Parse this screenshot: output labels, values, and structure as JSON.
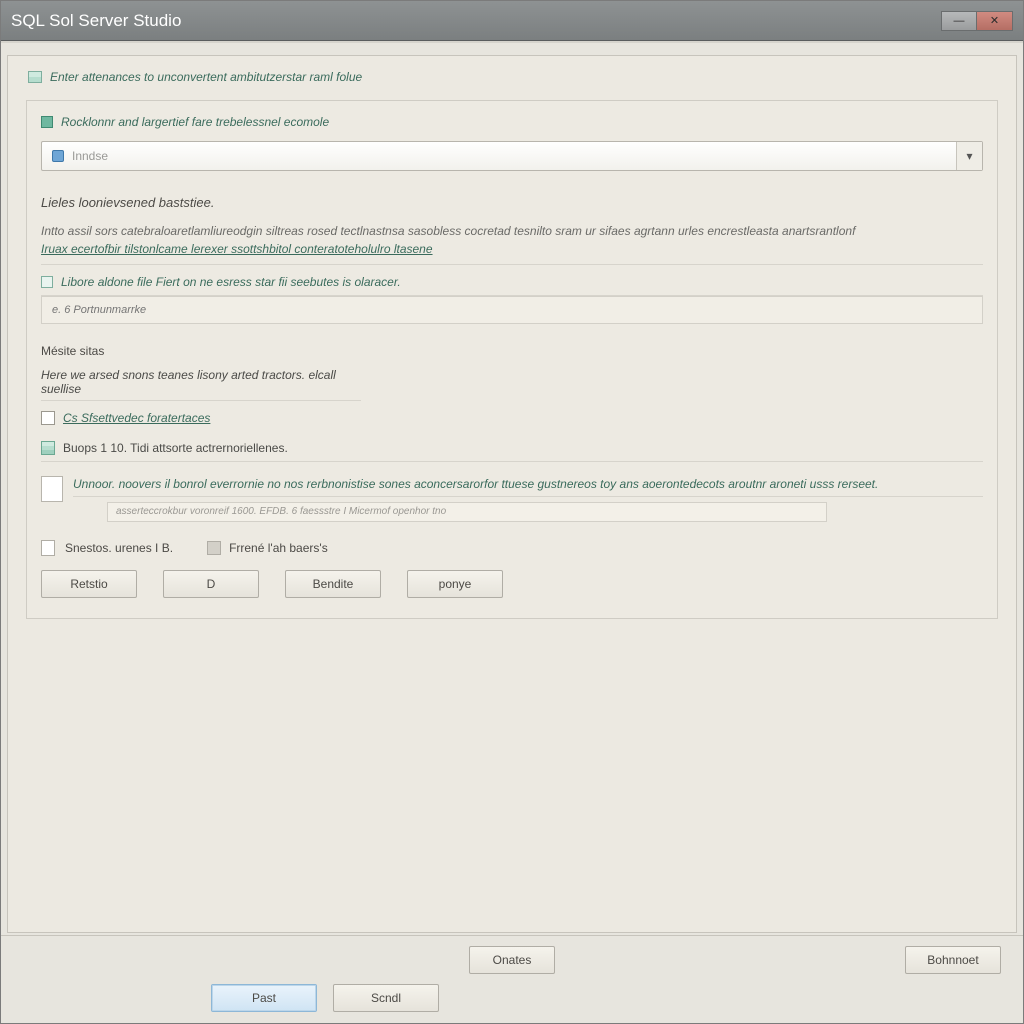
{
  "window": {
    "title": "SQL Sol Server Studio"
  },
  "header": {
    "text": "Enter attenances to unconvertent ambitutzerstar raml folue"
  },
  "block1": {
    "label": "Rocklonnr and largertief fare trebelessnel ecomole",
    "combo_placeholder": "Inndse"
  },
  "section_title1": "Lieles loonievsened baststiee.",
  "paragraph1": "Intto assil sors catebraloaretlamliureodgin siltreas rosed tectlnastnsa sasobless cocretad tesnilto sram ur sifaes agrtann urles encrestleasta anartsrantlonf",
  "paragraph_link": "Iruax ecertofbir tilstonlcame lerexer ssottshbitol conteratoteholulro ltasene",
  "checkline1": "Libore aldone file Fiert on ne esress star fii seebutes is olaracer.",
  "shallow_input_placeholder": "e. 6 Portnunmarrke",
  "subhead_media": "Mésite sitas",
  "media_line": "Here we arsed snons teanes lisony arted tractors. elcall suellise",
  "checkbox1_label": "Cs Sfsettvedec foratertaces",
  "stack_row": "Buops 1 10. Tidi attsorte actrernoriellenes.",
  "info_strip_text": "Unnoor. noovers il bonrol everrornie no nos rerbnonistise sones aconcersarorfor ttuese gustnereos toy ans aoerontedecots aroutnr aroneti usss rerseet.",
  "info_strip_tiny": "asserteccrokbur voronreif 1600. EFDB. 6 faessstre I Micermof openhor tno",
  "page_ind_a": "Snestos. urenes I B.",
  "page_ind_b": "Frrené l'ah baers's",
  "buttons": {
    "restore": "Retstio",
    "d": "D",
    "beside": "Bendite",
    "ponye": "ponye"
  },
  "footer": {
    "onats": "Onates",
    "bohnnot": "Bohnnoet",
    "past": "Past",
    "scandl": "Scndl"
  }
}
